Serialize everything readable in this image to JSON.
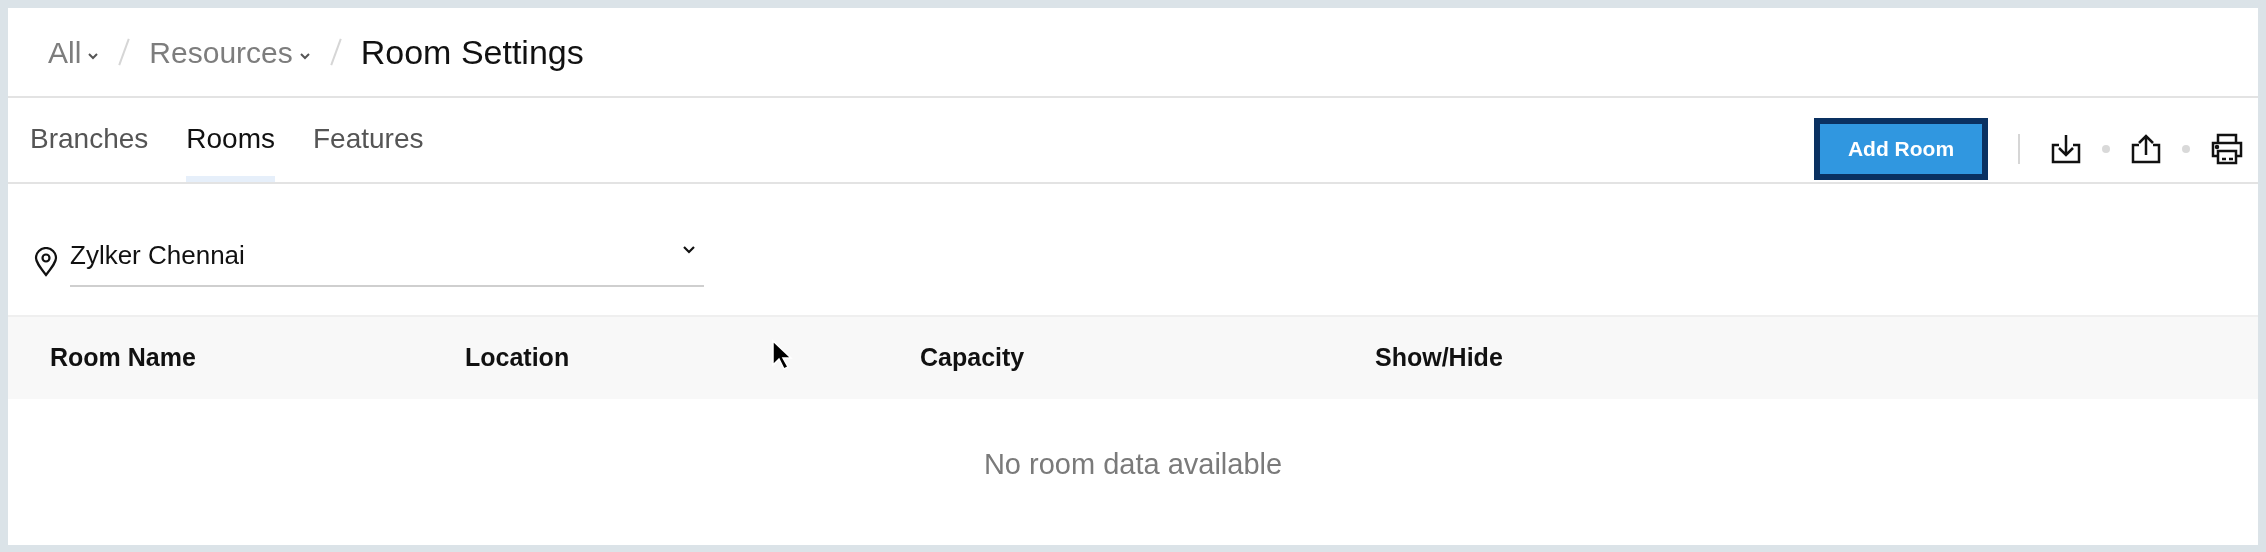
{
  "breadcrumb": [
    {
      "label": "All",
      "dropdown": true
    },
    {
      "label": "Resources",
      "dropdown": true
    },
    {
      "label": "Room Settings",
      "dropdown": false
    }
  ],
  "tabs": [
    {
      "label": "Branches",
      "selected": false
    },
    {
      "label": "Rooms",
      "selected": true
    },
    {
      "label": "Features",
      "selected": false
    }
  ],
  "primary_button": "Add Room",
  "branch_select": {
    "value": "Zylker Chennai"
  },
  "table": {
    "columns": [
      "Room Name",
      "Location",
      "Capacity",
      "Show/Hide"
    ],
    "empty_message": "No room data available"
  }
}
